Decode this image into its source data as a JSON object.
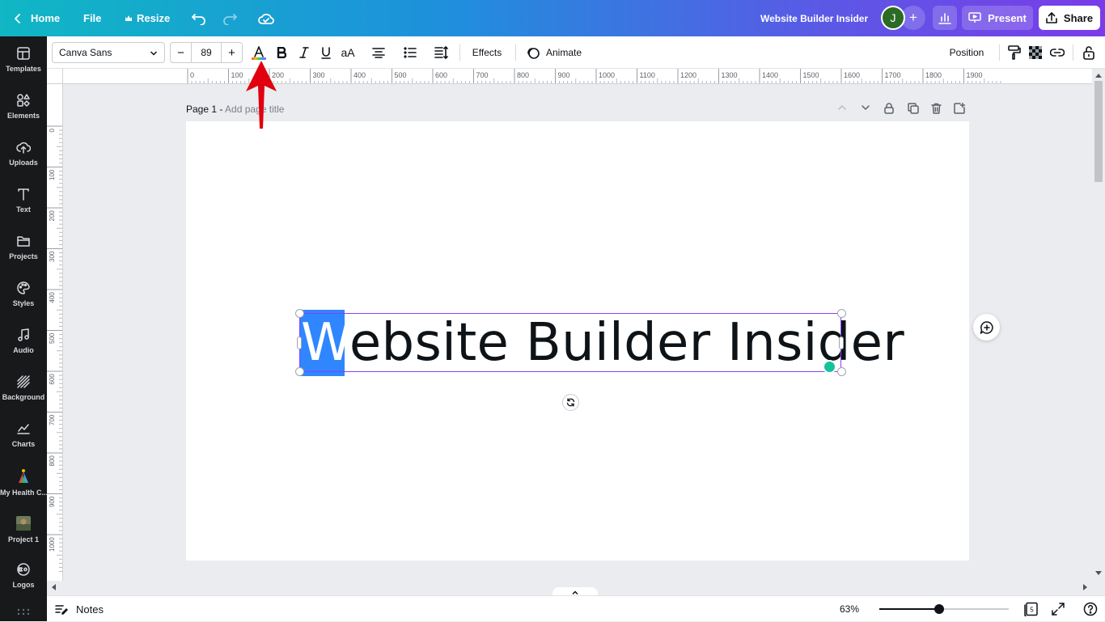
{
  "topbar": {
    "home_label": "Home",
    "file_label": "File",
    "resize_label": "Resize",
    "design_title": "Website Builder Insider",
    "avatar_initial": "J",
    "add_label": "+",
    "present_label": "Present",
    "share_label": "Share"
  },
  "sidebar": {
    "items": [
      {
        "label": "Templates",
        "icon": "templates-icon"
      },
      {
        "label": "Elements",
        "icon": "elements-icon"
      },
      {
        "label": "Uploads",
        "icon": "uploads-icon"
      },
      {
        "label": "Text",
        "icon": "text-icon"
      },
      {
        "label": "Projects",
        "icon": "folder-icon"
      },
      {
        "label": "Styles",
        "icon": "palette-icon"
      },
      {
        "label": "Audio",
        "icon": "music-icon"
      },
      {
        "label": "Background",
        "icon": "background-icon"
      },
      {
        "label": "Charts",
        "icon": "chart-icon"
      },
      {
        "label": "My Health C...",
        "icon": "app-thumbnail"
      },
      {
        "label": "Project 1",
        "icon": "project-thumbnail"
      },
      {
        "label": "Logos",
        "icon": "logo-icon"
      }
    ]
  },
  "toolbar": {
    "font_name": "Canva Sans",
    "size_minus": "−",
    "font_size": "89",
    "size_plus": "+",
    "case_label": "aA",
    "effects_label": "Effects",
    "animate_label": "Animate",
    "position_label": "Position"
  },
  "ruler": {
    "top_ticks": [
      "0",
      "100",
      "200",
      "300",
      "400",
      "500",
      "600",
      "700",
      "800",
      "900",
      "1000",
      "1100",
      "1200",
      "1300",
      "1400",
      "1500",
      "1600",
      "1700",
      "1800",
      "1900"
    ],
    "left_ticks": [
      "0",
      "100",
      "200",
      "300",
      "400",
      "500",
      "600",
      "700",
      "800",
      "900",
      "1000"
    ]
  },
  "canvas": {
    "page_label": "Page 1 - ",
    "page_title_placeholder": "Add page title",
    "text_selected": "W",
    "text_rest": "ebsite Builder Insider"
  },
  "bottombar": {
    "notes_label": "Notes",
    "zoom_label": "63%",
    "zoom_level": 0.46,
    "page_count": "5"
  },
  "colors": {
    "accent": "#8b3dff",
    "selection": "#2f86ff",
    "annotation": "#e0000f"
  }
}
